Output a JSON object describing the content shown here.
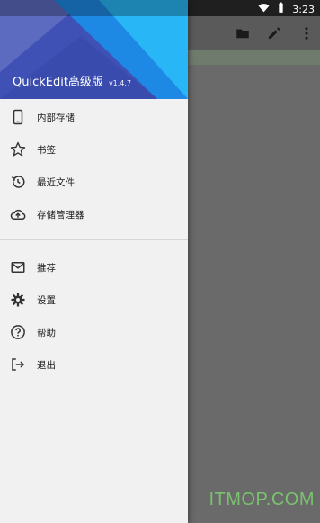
{
  "status_bar": {
    "time": "3:23",
    "icons": [
      "wifi-icon",
      "battery-icon"
    ]
  },
  "toolbar": {
    "actions": [
      "open-folder-icon",
      "edit-icon",
      "more-vert-icon"
    ]
  },
  "drawer": {
    "header": {
      "app_name": "QuickEdit高级版",
      "version": "v1.4.7",
      "colors": [
        "#3f51b5",
        "#5c6bc0",
        "#29b6f6",
        "#1e88e5"
      ]
    },
    "primary_items": [
      {
        "label": "内部存储",
        "icon": "phone-icon"
      },
      {
        "label": "书签",
        "icon": "star-icon"
      },
      {
        "label": "最近文件",
        "icon": "history-icon"
      },
      {
        "label": "存储管理器",
        "icon": "cloud-upload-icon"
      }
    ],
    "secondary_items": [
      {
        "label": "推荐",
        "icon": "mail-icon"
      },
      {
        "label": "设置",
        "icon": "gear-icon"
      },
      {
        "label": "帮助",
        "icon": "help-icon"
      },
      {
        "label": "退出",
        "icon": "exit-icon"
      }
    ]
  },
  "watermark": "ITMOP.COM"
}
